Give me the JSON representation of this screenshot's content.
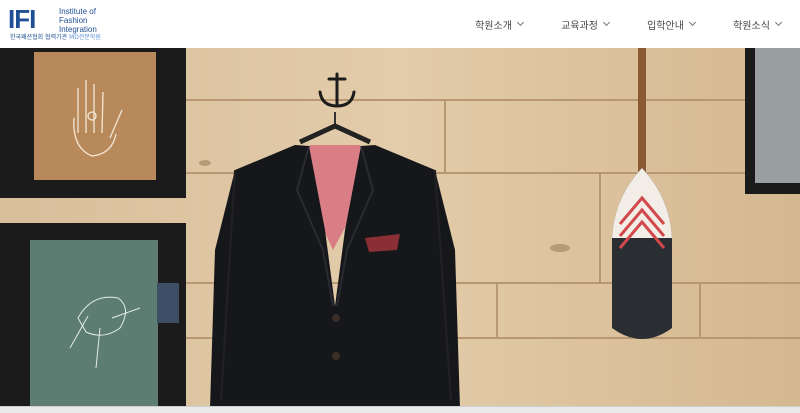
{
  "logo": {
    "mark": "IFI",
    "name_lines": [
      "Institute of",
      "Fashion",
      "Integration"
    ],
    "sub_left": "한국패션협회",
    "sub_mid": "협력기관",
    "sub_right": "MD전문학원"
  },
  "nav": {
    "items": [
      {
        "label": "학원소개"
      },
      {
        "label": "교육과정"
      },
      {
        "label": "입학안내"
      },
      {
        "label": "학원소식"
      }
    ]
  }
}
